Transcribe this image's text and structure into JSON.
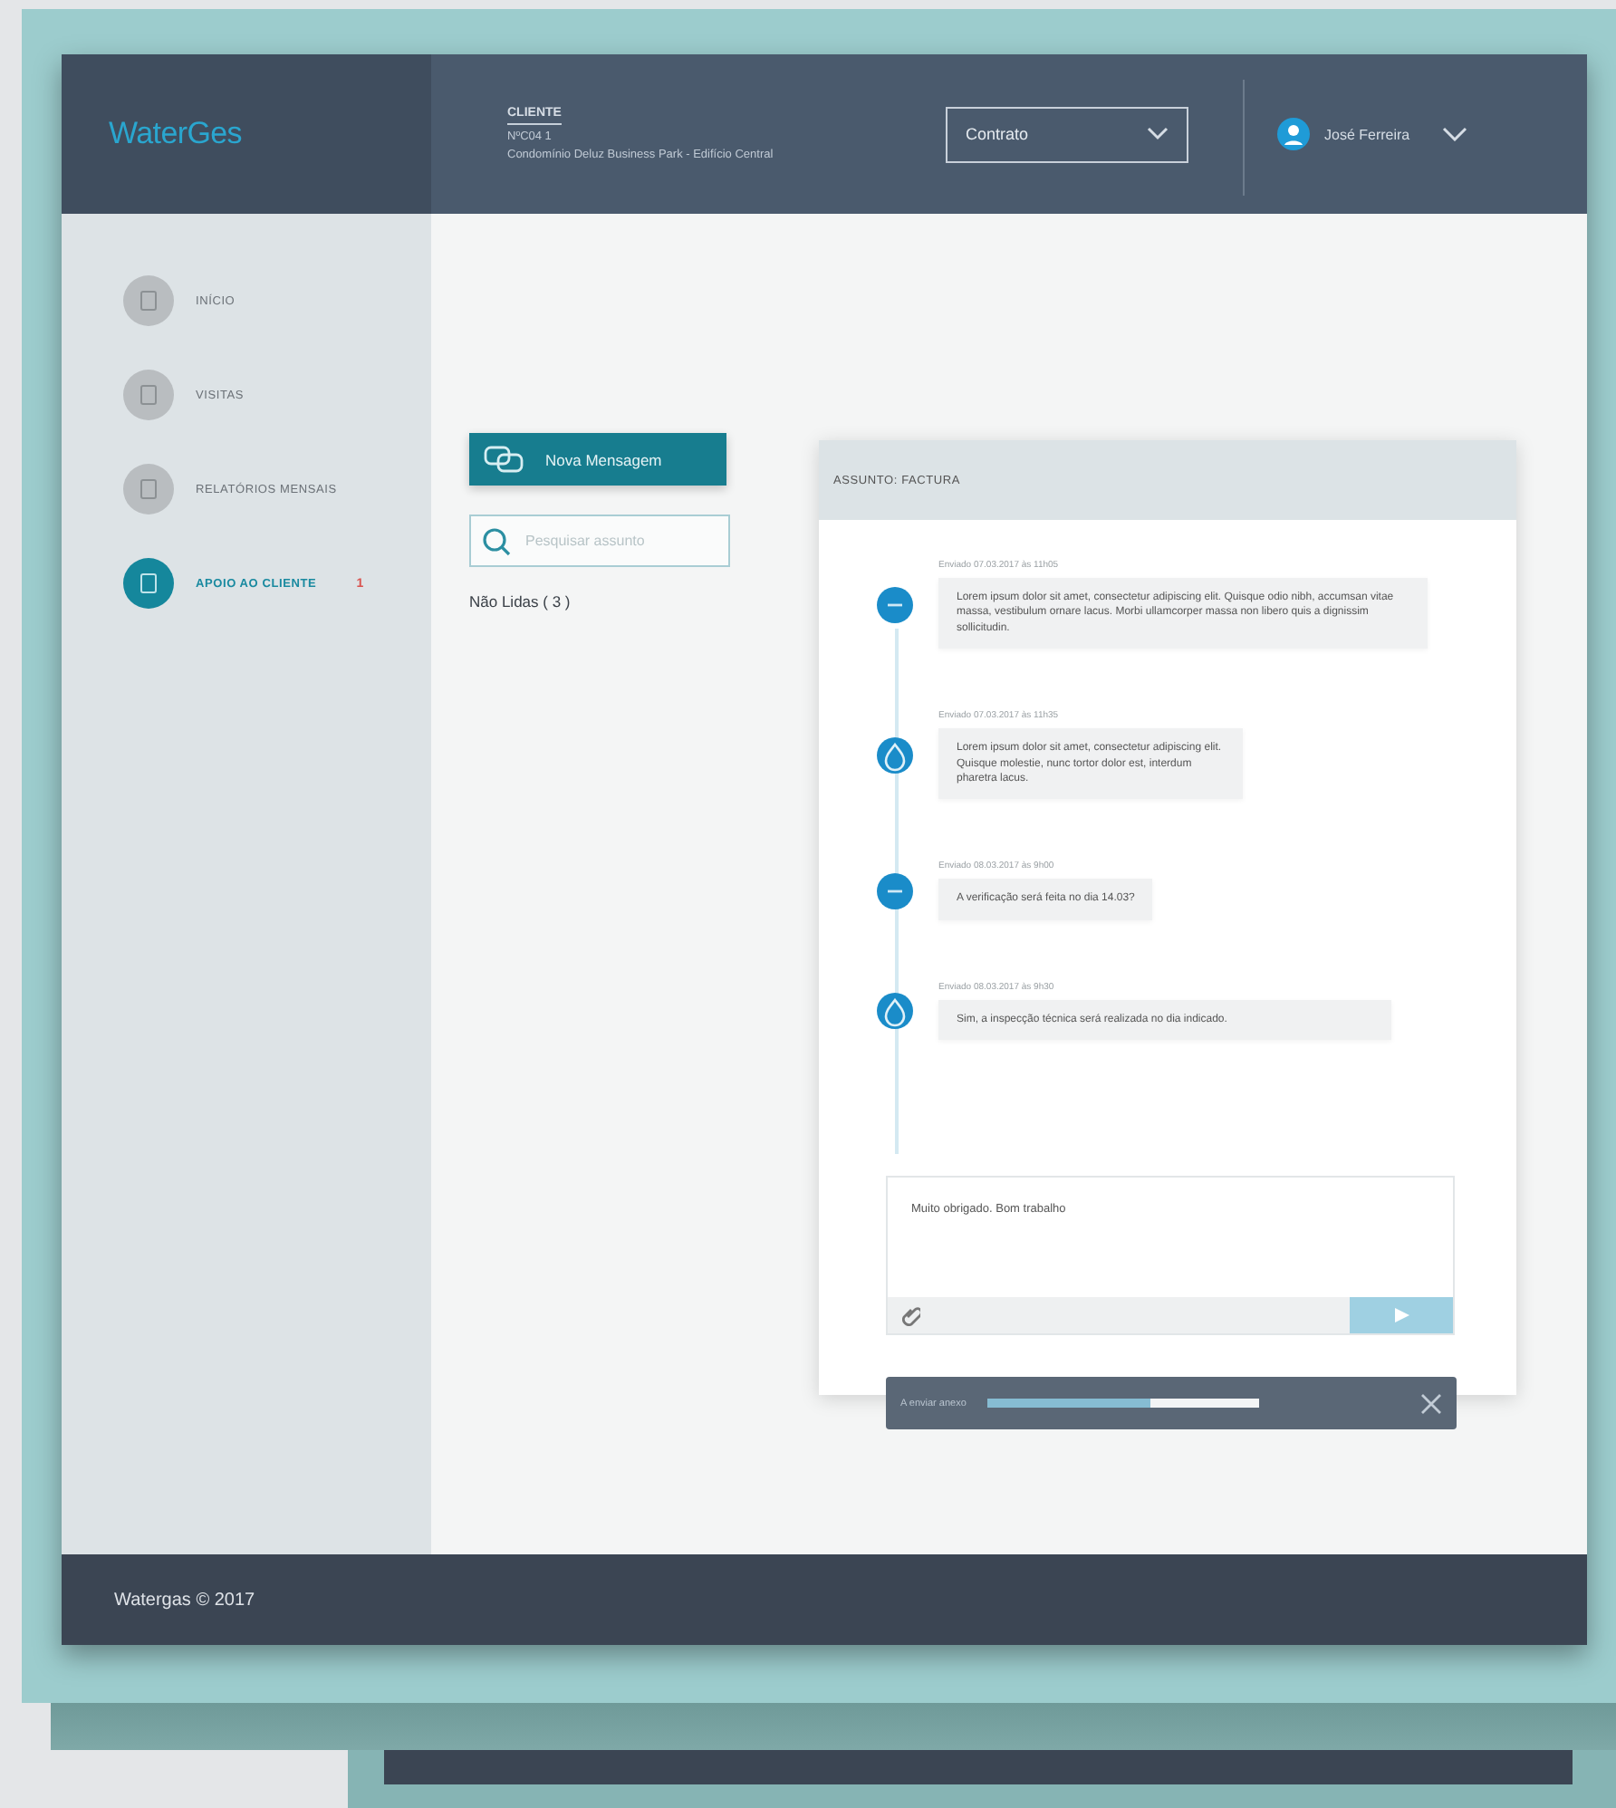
{
  "brand": {
    "logo": "WaterGes"
  },
  "header": {
    "client_label": "CLIENTE",
    "client_id": "NºC04 1",
    "client_name": "Condomínio Deluz Business Park - Edifício Central",
    "contract_select": {
      "value": "Contrato"
    },
    "user": {
      "name": "José Ferreira"
    }
  },
  "sidebar": {
    "items": [
      {
        "label": "INÍCIO",
        "selected": false
      },
      {
        "label": "VISITAS",
        "selected": false
      },
      {
        "label": "RELATÓRIOS MENSAIS",
        "selected": false
      },
      {
        "label": "APOIO AO CLIENTE",
        "selected": true,
        "badge": "1"
      }
    ]
  },
  "messages_list": {
    "new_button": "Nova Mensagem",
    "search": {
      "placeholder": "Pesquisar assunto"
    },
    "unread": "Não Lidas ( 3 )"
  },
  "conversation": {
    "subject": "ASSUNTO: FACTURA",
    "messages": [
      {
        "kind": "client",
        "meta": "Enviado 07.03.2017 às 11h05",
        "text": "Lorem ipsum dolor sit amet, consectetur adipiscing elit. Quisque odio nibh, accumsan vitae massa, vestibulum ornare lacus. Morbi ullamcorper massa non libero quis a dignissim sollicitudin."
      },
      {
        "kind": "staff",
        "meta": "Enviado 07.03.2017 às 11h35",
        "text": "Lorem ipsum dolor sit amet, consectetur adipiscing elit. Quisque molestie, nunc tortor dolor est, interdum pharetra lacus."
      },
      {
        "kind": "client",
        "meta": "Enviado 08.03.2017 às 9h00",
        "text": "A verificação será feita no dia 14.03?"
      },
      {
        "kind": "staff",
        "meta": "Enviado 08.03.2017 às 9h30",
        "text": "Sim, a inspecção técnica será realizada no dia indicado."
      }
    ],
    "compose": {
      "value": "Muito obrigado. Bom trabalho"
    },
    "upload": {
      "label": "A enviar anexo",
      "level": 0.6
    }
  },
  "footer": {
    "text": "Watergas © 2017"
  }
}
